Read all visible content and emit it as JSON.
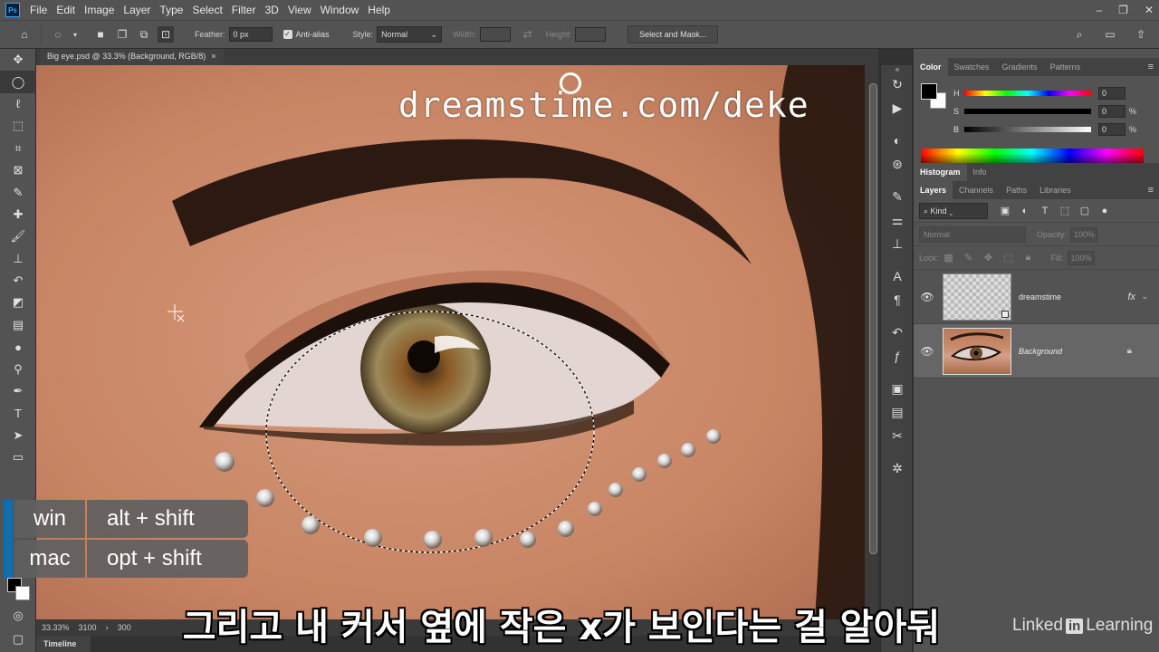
{
  "app": {
    "logo": "Ps"
  },
  "menu": [
    "File",
    "Edit",
    "Image",
    "Layer",
    "Type",
    "Select",
    "Filter",
    "3D",
    "View",
    "Window",
    "Help"
  ],
  "window_controls": [
    "–",
    "❐",
    "✕"
  ],
  "options": {
    "feather_label": "Feather:",
    "feather_value": "0 px",
    "antialias_label": "Anti-alias",
    "style_label": "Style:",
    "style_value": "Normal",
    "width_label": "Width:",
    "height_label": "Height:",
    "select_mask_label": "Select and Mask..."
  },
  "document": {
    "tab_title": "Big eye.psd @ 33.3% (Background, RGB/8)",
    "watermark": "dreamstime.com/deke",
    "zoom": "33.33%",
    "doc_info": "3100",
    "doc_info2": "300"
  },
  "timeline_label": "Timeline",
  "shortcut": {
    "win_key": "win",
    "win_combo": "alt + shift",
    "mac_key": "mac",
    "mac_combo": "opt + shift"
  },
  "subtitle": "그리고 내 커서 옆에 작은 x가 보인다는 걸 알아둬",
  "brand": {
    "pre": "Linked",
    "box": "in",
    "post": "Learning"
  },
  "color_panel": {
    "tabs": [
      "Color",
      "Swatches",
      "Gradients",
      "Patterns"
    ],
    "h_label": "H",
    "h_value": "0",
    "s_label": "S",
    "s_value": "0",
    "s_unit": "%",
    "b_label": "B",
    "b_value": "0",
    "b_unit": "%"
  },
  "hist_tabs": [
    "Histogram",
    "Info"
  ],
  "layers_panel": {
    "tabs": [
      "Layers",
      "Channels",
      "Paths",
      "Libraries"
    ],
    "kind": "Kind",
    "blend_mode": "Normal",
    "opacity_label": "Opacity:",
    "opacity_value": "100%",
    "lock_label": "Lock:",
    "fill_label": "Fill:",
    "fill_value": "100%",
    "layers": [
      {
        "name": "dreamstime",
        "fx": "fx"
      },
      {
        "name": "Background"
      }
    ]
  },
  "colors": {
    "accent": "#0a6fb5",
    "chrome": "#535353",
    "skin": "#c8896a"
  }
}
